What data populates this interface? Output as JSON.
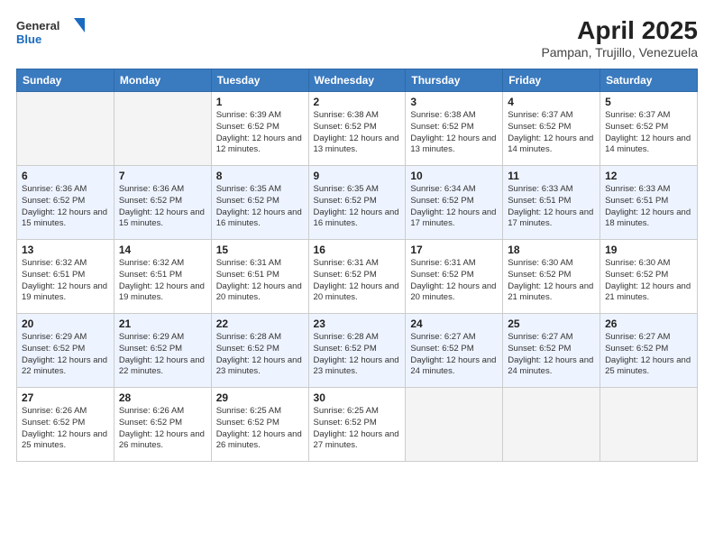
{
  "header": {
    "logo_general": "General",
    "logo_blue": "Blue",
    "title": "April 2025",
    "subtitle": "Pampan, Trujillo, Venezuela"
  },
  "weekdays": [
    "Sunday",
    "Monday",
    "Tuesday",
    "Wednesday",
    "Thursday",
    "Friday",
    "Saturday"
  ],
  "weeks": [
    [
      {
        "day": null
      },
      {
        "day": null
      },
      {
        "day": "1",
        "sunrise": "Sunrise: 6:39 AM",
        "sunset": "Sunset: 6:52 PM",
        "daylight": "Daylight: 12 hours and 12 minutes."
      },
      {
        "day": "2",
        "sunrise": "Sunrise: 6:38 AM",
        "sunset": "Sunset: 6:52 PM",
        "daylight": "Daylight: 12 hours and 13 minutes."
      },
      {
        "day": "3",
        "sunrise": "Sunrise: 6:38 AM",
        "sunset": "Sunset: 6:52 PM",
        "daylight": "Daylight: 12 hours and 13 minutes."
      },
      {
        "day": "4",
        "sunrise": "Sunrise: 6:37 AM",
        "sunset": "Sunset: 6:52 PM",
        "daylight": "Daylight: 12 hours and 14 minutes."
      },
      {
        "day": "5",
        "sunrise": "Sunrise: 6:37 AM",
        "sunset": "Sunset: 6:52 PM",
        "daylight": "Daylight: 12 hours and 14 minutes."
      }
    ],
    [
      {
        "day": "6",
        "sunrise": "Sunrise: 6:36 AM",
        "sunset": "Sunset: 6:52 PM",
        "daylight": "Daylight: 12 hours and 15 minutes."
      },
      {
        "day": "7",
        "sunrise": "Sunrise: 6:36 AM",
        "sunset": "Sunset: 6:52 PM",
        "daylight": "Daylight: 12 hours and 15 minutes."
      },
      {
        "day": "8",
        "sunrise": "Sunrise: 6:35 AM",
        "sunset": "Sunset: 6:52 PM",
        "daylight": "Daylight: 12 hours and 16 minutes."
      },
      {
        "day": "9",
        "sunrise": "Sunrise: 6:35 AM",
        "sunset": "Sunset: 6:52 PM",
        "daylight": "Daylight: 12 hours and 16 minutes."
      },
      {
        "day": "10",
        "sunrise": "Sunrise: 6:34 AM",
        "sunset": "Sunset: 6:52 PM",
        "daylight": "Daylight: 12 hours and 17 minutes."
      },
      {
        "day": "11",
        "sunrise": "Sunrise: 6:33 AM",
        "sunset": "Sunset: 6:51 PM",
        "daylight": "Daylight: 12 hours and 17 minutes."
      },
      {
        "day": "12",
        "sunrise": "Sunrise: 6:33 AM",
        "sunset": "Sunset: 6:51 PM",
        "daylight": "Daylight: 12 hours and 18 minutes."
      }
    ],
    [
      {
        "day": "13",
        "sunrise": "Sunrise: 6:32 AM",
        "sunset": "Sunset: 6:51 PM",
        "daylight": "Daylight: 12 hours and 19 minutes."
      },
      {
        "day": "14",
        "sunrise": "Sunrise: 6:32 AM",
        "sunset": "Sunset: 6:51 PM",
        "daylight": "Daylight: 12 hours and 19 minutes."
      },
      {
        "day": "15",
        "sunrise": "Sunrise: 6:31 AM",
        "sunset": "Sunset: 6:51 PM",
        "daylight": "Daylight: 12 hours and 20 minutes."
      },
      {
        "day": "16",
        "sunrise": "Sunrise: 6:31 AM",
        "sunset": "Sunset: 6:52 PM",
        "daylight": "Daylight: 12 hours and 20 minutes."
      },
      {
        "day": "17",
        "sunrise": "Sunrise: 6:31 AM",
        "sunset": "Sunset: 6:52 PM",
        "daylight": "Daylight: 12 hours and 20 minutes."
      },
      {
        "day": "18",
        "sunrise": "Sunrise: 6:30 AM",
        "sunset": "Sunset: 6:52 PM",
        "daylight": "Daylight: 12 hours and 21 minutes."
      },
      {
        "day": "19",
        "sunrise": "Sunrise: 6:30 AM",
        "sunset": "Sunset: 6:52 PM",
        "daylight": "Daylight: 12 hours and 21 minutes."
      }
    ],
    [
      {
        "day": "20",
        "sunrise": "Sunrise: 6:29 AM",
        "sunset": "Sunset: 6:52 PM",
        "daylight": "Daylight: 12 hours and 22 minutes."
      },
      {
        "day": "21",
        "sunrise": "Sunrise: 6:29 AM",
        "sunset": "Sunset: 6:52 PM",
        "daylight": "Daylight: 12 hours and 22 minutes."
      },
      {
        "day": "22",
        "sunrise": "Sunrise: 6:28 AM",
        "sunset": "Sunset: 6:52 PM",
        "daylight": "Daylight: 12 hours and 23 minutes."
      },
      {
        "day": "23",
        "sunrise": "Sunrise: 6:28 AM",
        "sunset": "Sunset: 6:52 PM",
        "daylight": "Daylight: 12 hours and 23 minutes."
      },
      {
        "day": "24",
        "sunrise": "Sunrise: 6:27 AM",
        "sunset": "Sunset: 6:52 PM",
        "daylight": "Daylight: 12 hours and 24 minutes."
      },
      {
        "day": "25",
        "sunrise": "Sunrise: 6:27 AM",
        "sunset": "Sunset: 6:52 PM",
        "daylight": "Daylight: 12 hours and 24 minutes."
      },
      {
        "day": "26",
        "sunrise": "Sunrise: 6:27 AM",
        "sunset": "Sunset: 6:52 PM",
        "daylight": "Daylight: 12 hours and 25 minutes."
      }
    ],
    [
      {
        "day": "27",
        "sunrise": "Sunrise: 6:26 AM",
        "sunset": "Sunset: 6:52 PM",
        "daylight": "Daylight: 12 hours and 25 minutes."
      },
      {
        "day": "28",
        "sunrise": "Sunrise: 6:26 AM",
        "sunset": "Sunset: 6:52 PM",
        "daylight": "Daylight: 12 hours and 26 minutes."
      },
      {
        "day": "29",
        "sunrise": "Sunrise: 6:25 AM",
        "sunset": "Sunset: 6:52 PM",
        "daylight": "Daylight: 12 hours and 26 minutes."
      },
      {
        "day": "30",
        "sunrise": "Sunrise: 6:25 AM",
        "sunset": "Sunset: 6:52 PM",
        "daylight": "Daylight: 12 hours and 27 minutes."
      },
      {
        "day": null
      },
      {
        "day": null
      },
      {
        "day": null
      }
    ]
  ]
}
